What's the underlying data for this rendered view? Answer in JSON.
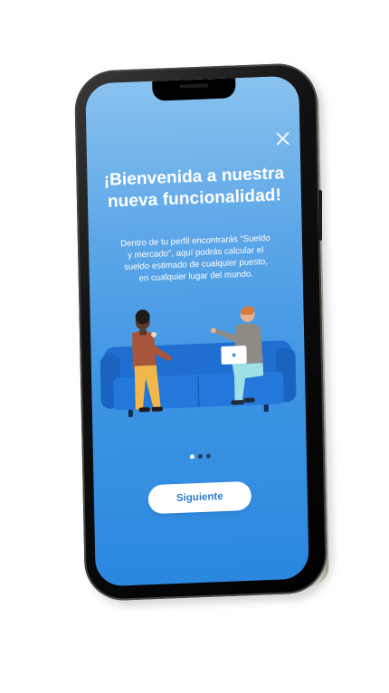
{
  "onboarding": {
    "title_line1": "¡Bienvenida a nuestra",
    "title_line2": "nueva funcionalidad!",
    "description_lines": [
      "Dentro de tu perfil encontrarás \"Sueldo",
      "y mercado\", aquí podrás calcular el",
      "sueldo estimado de cualquier puesto,",
      "en cualquier lugar del mundo."
    ],
    "next_button_label": "Siguiente",
    "pager": {
      "total": 3,
      "current": 1
    }
  },
  "icons": {
    "close": "close-icon"
  },
  "colors": {
    "screen_top": "#89c2ee",
    "screen_bottom": "#2b87df",
    "sofa": "#1f6fd1",
    "button_text": "#2b7dd3"
  }
}
